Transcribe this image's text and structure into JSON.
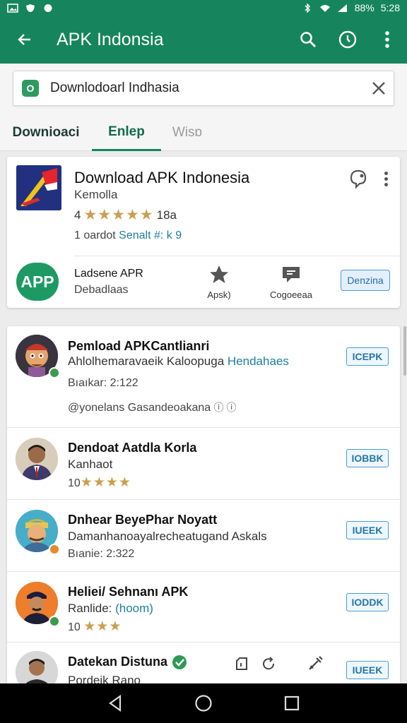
{
  "status_bar": {
    "battery": "88%",
    "time": "5:28"
  },
  "app_bar": {
    "title": "APK Indonsia",
    "back_icon": "arrow-back-icon",
    "search_icon": "search-icon",
    "history_icon": "clock-icon",
    "more_icon": "more-vert-icon"
  },
  "search": {
    "badge": "O",
    "query": "Downlodoarl Indhasia"
  },
  "tabs": [
    {
      "label": "Downioaci"
    },
    {
      "label": "Enlep"
    },
    {
      "label": "Wisɒ"
    }
  ],
  "featured": {
    "title": "Download APK Indonesia",
    "developer": "Kemolla",
    "rating_prefix": "4",
    "stars": "★★★★★",
    "rating_count": "18a",
    "info_prefix": "1 oardot",
    "info_highlight": "Senalt #: k 9",
    "app_logo": "APP",
    "section_title": "Ladsene APR",
    "section_sub": "Debadlaas",
    "action1_label": "Apsk)",
    "action2_label": "Cogoeeaa",
    "download_button": "Denzina",
    "accent_color": "#16855e"
  },
  "list": [
    {
      "title": "Pemload APKCantlianri",
      "subtitle": "Ahlolhemaravaeik Kaloopuga",
      "subtitle_highlight": "Hendahaes",
      "meta": "Bıaıkar: 2:122",
      "meta2": "@yonelans Gasandeoakana",
      "button": "ICEPK"
    },
    {
      "title": "Dendoat Aatdla Korla",
      "subtitle": "Kanhaot",
      "meta": "10",
      "stars": "★★★★",
      "button": "IOBBK"
    },
    {
      "title": "Dnhear BeyePhar Noyatt",
      "subtitle": "Damanhanoayalrecheatugand Askals",
      "meta": "Bıanie: 2:322",
      "button": "IUEEK"
    },
    {
      "title": "Heliei/ Sehnanı APK",
      "subtitle": "Ranlide:",
      "subtitle_highlight": "(hoom)",
      "meta": "10",
      "stars": "★★★",
      "button": "IODDK"
    },
    {
      "title": "Datekan Distuna",
      "subtitle": "Pordeik Rano",
      "button": "IUEEK"
    }
  ]
}
